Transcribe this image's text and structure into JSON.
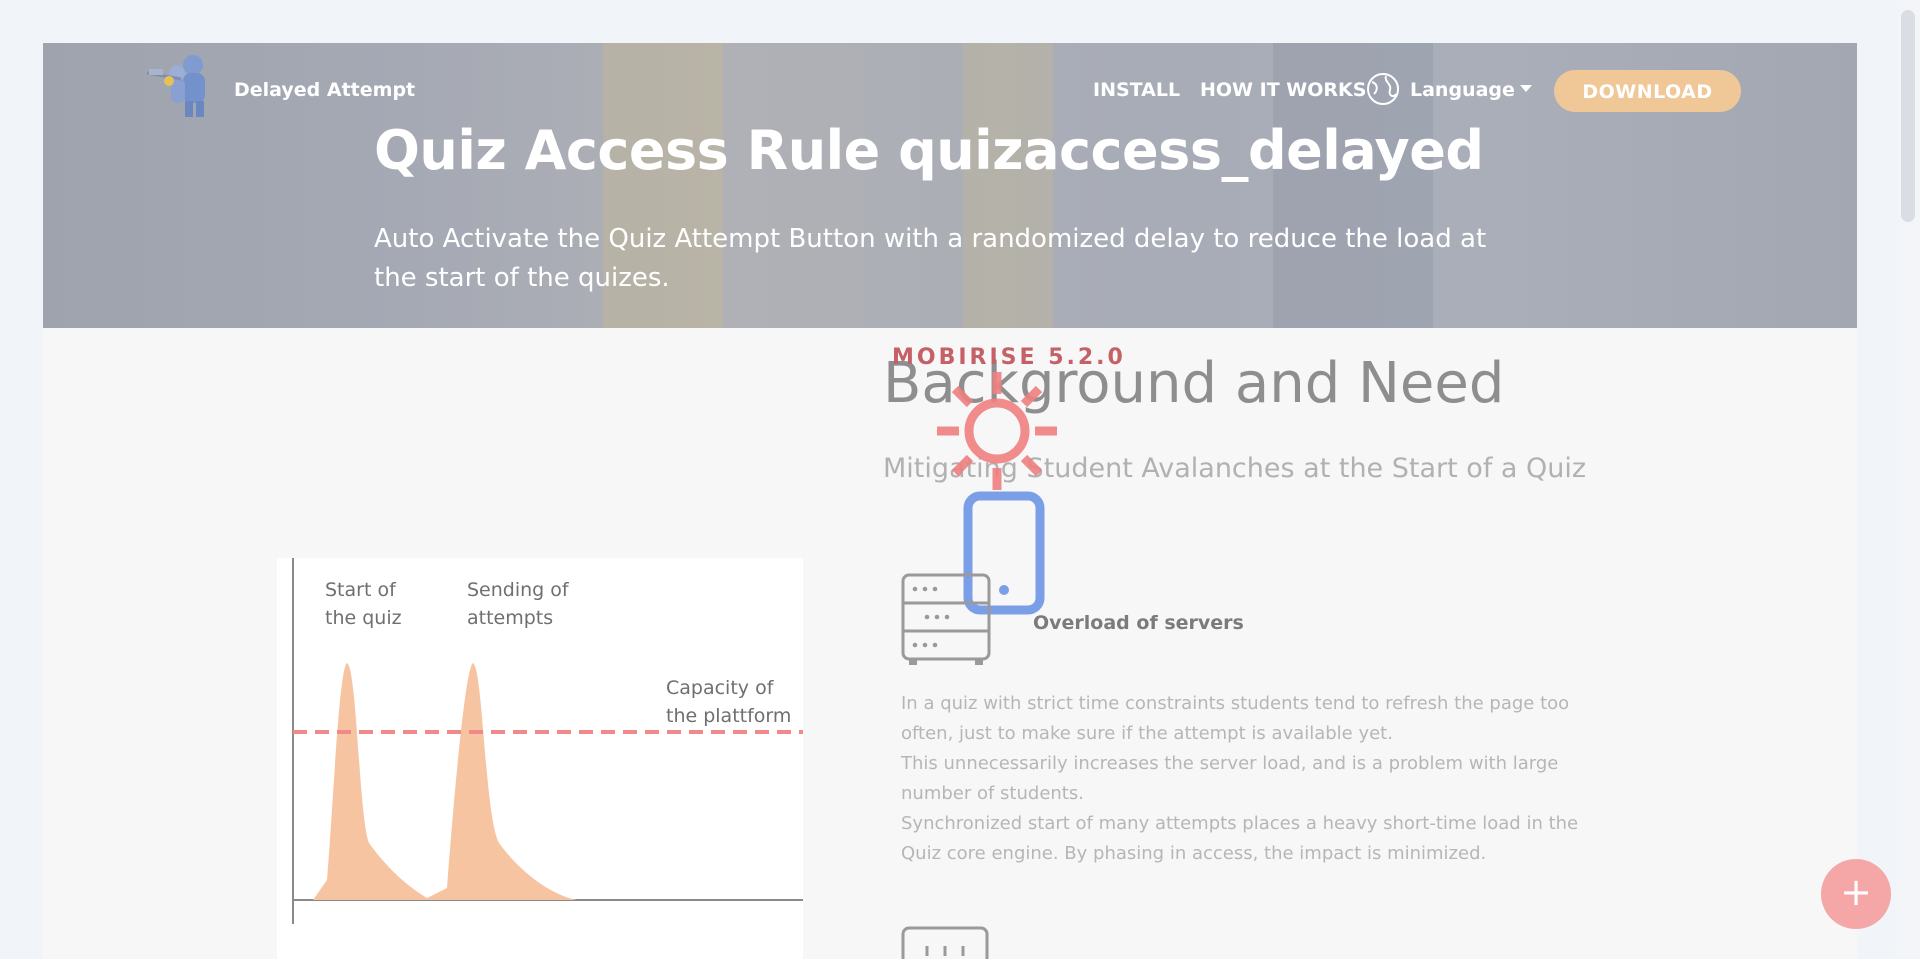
{
  "navbar": {
    "logo_icon": "mascot-logo-icon",
    "brand": "Delayed Attempt",
    "links": [
      "INSTALL",
      "HOW IT WORKS"
    ],
    "language_icon": "globe-icon",
    "language_label": "Language",
    "download_label": "DOWNLOAD"
  },
  "hero": {
    "title": "Quiz Access Rule quizaccess_delayed",
    "subtitle": "Auto Activate the Quiz Attempt Button with a randomized delay to reduce the load at the start of the quizes."
  },
  "loader": {
    "text": "MOBIRISE 5.2.0",
    "icons": [
      "sun-icon",
      "phone-icon"
    ]
  },
  "section": {
    "title": "Background and Need",
    "subtitle": "Mitigating Student Avalanches at the Start of a Quiz",
    "figure": {
      "labels": [
        "Start of",
        "the quiz",
        "Sending of",
        "attempts",
        "Capacity of",
        "the plattform"
      ]
    },
    "feature": {
      "icon": "server-icon",
      "title": "Overload of servers",
      "paragraphs": [
        "In a quiz with strict time constraints students tend to refresh the page too often, just to make sure if the attempt is available yet.",
        "This unnecessarily increases the server load, and is a problem with large number of students.",
        "Synchronized start of many attempts places a heavy short-time load in the Quiz core engine. By phasing in access, the impact is minimized."
      ]
    },
    "next_feature_icon": "dashboard-icon"
  },
  "fab": {
    "symbol": "+",
    "icon": "plus-icon"
  },
  "colors": {
    "hero_overlay": "#a5a9b4",
    "download_button": "#f0c898",
    "loader": "#c56066",
    "peak_fill": "#f7c4a2",
    "capacity_line": "#f1888a",
    "fab": "#f4a7a6"
  }
}
